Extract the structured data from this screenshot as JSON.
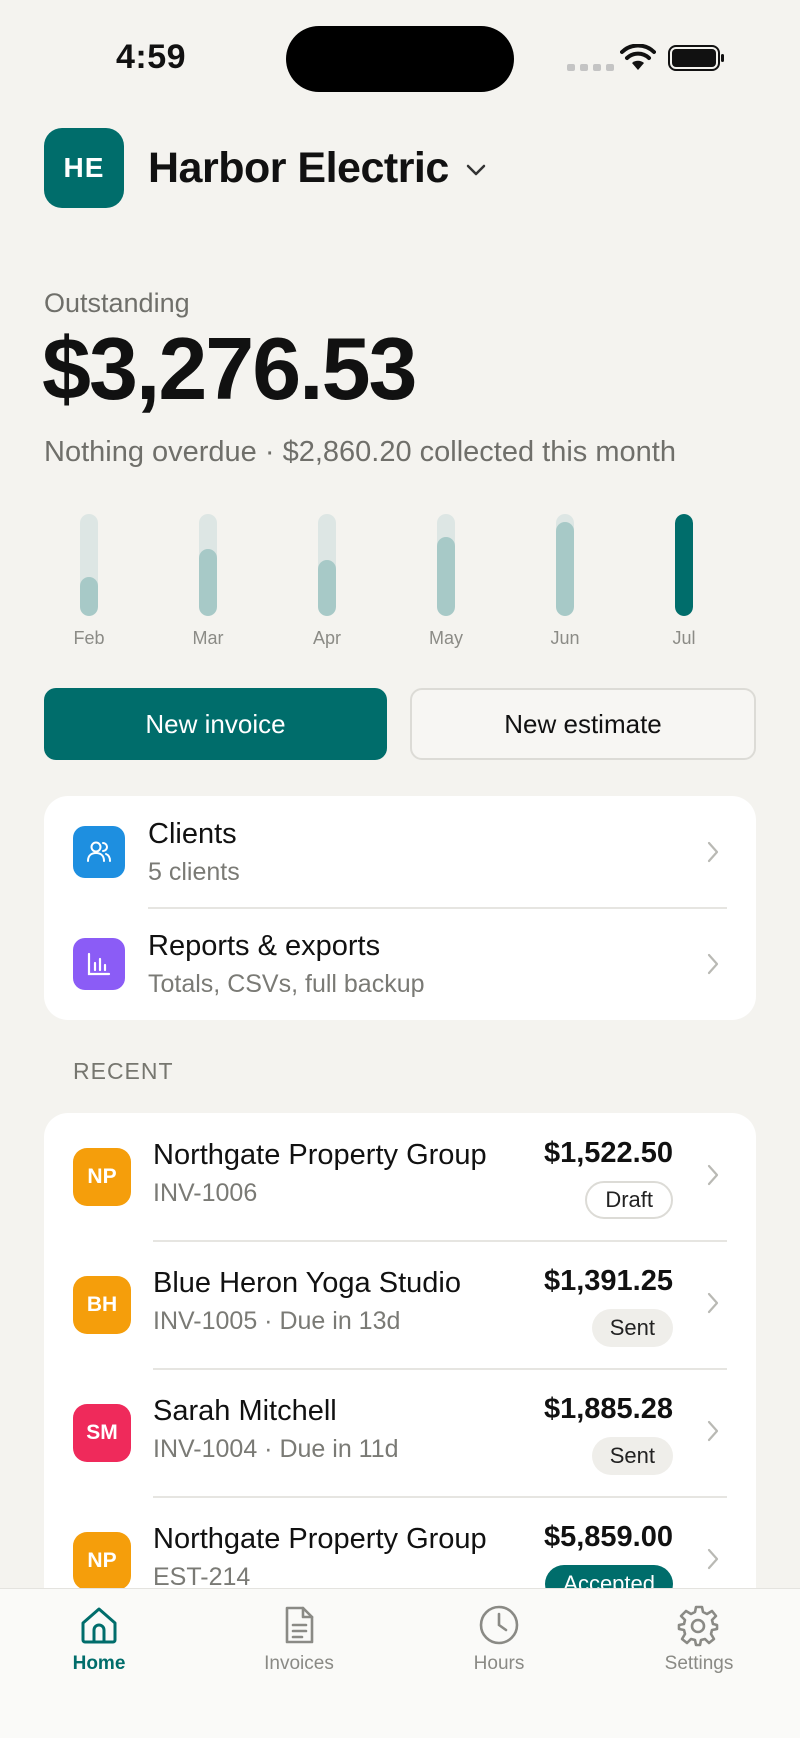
{
  "status_bar": {
    "time": "4:59"
  },
  "business": {
    "initials": "HE",
    "name": "Harbor Electric"
  },
  "summary": {
    "outstanding_label": "Outstanding",
    "outstanding_amount": "$3,276.53",
    "subtitle": "Nothing overdue · $2,860.20 collected this month"
  },
  "chart_data": {
    "type": "bar",
    "categories": [
      "Feb",
      "Mar",
      "Apr",
      "May",
      "Jun",
      "Jul"
    ],
    "values": [
      0.38,
      0.66,
      0.55,
      0.77,
      0.92,
      1.0
    ],
    "highlight": "Jul",
    "colors": {
      "track": "#dde6e4",
      "fill": "#a7c9c7",
      "current": "#006d6b"
    }
  },
  "actions": {
    "new_invoice": "New invoice",
    "new_estimate": "New estimate"
  },
  "nav_items": [
    {
      "title": "Clients",
      "subtitle": "5 clients",
      "icon": "users-icon",
      "color": "#1e8fe0"
    },
    {
      "title": "Reports & exports",
      "subtitle": "Totals, CSVs, full backup",
      "icon": "bar-chart-icon",
      "color": "#8b5cf6"
    }
  ],
  "recent": {
    "label": "RECENT",
    "items": [
      {
        "initials": "NP",
        "name": "Northgate Property Group",
        "meta": "INV-1006",
        "amount": "$1,522.50",
        "status": "Draft",
        "color": "#f59e0b"
      },
      {
        "initials": "BH",
        "name": "Blue Heron Yoga Studio",
        "meta": "INV-1005 · Due in 13d",
        "amount": "$1,391.25",
        "status": "Sent",
        "color": "#f59e0b"
      },
      {
        "initials": "SM",
        "name": "Sarah Mitchell",
        "meta": "INV-1004 · Due in 11d",
        "amount": "$1,885.28",
        "status": "Sent",
        "color": "#ef2a5b"
      },
      {
        "initials": "NP",
        "name": "Northgate Property Group",
        "meta": "EST-214",
        "amount": "$5,859.00",
        "status": "Accepted",
        "color": "#f59e0b"
      }
    ]
  },
  "tabs": [
    {
      "label": "Home",
      "icon": "home-icon",
      "active": true
    },
    {
      "label": "Invoices",
      "icon": "document-icon",
      "active": false
    },
    {
      "label": "Hours",
      "icon": "clock-icon",
      "active": false
    },
    {
      "label": "Settings",
      "icon": "gear-icon",
      "active": false
    }
  ]
}
